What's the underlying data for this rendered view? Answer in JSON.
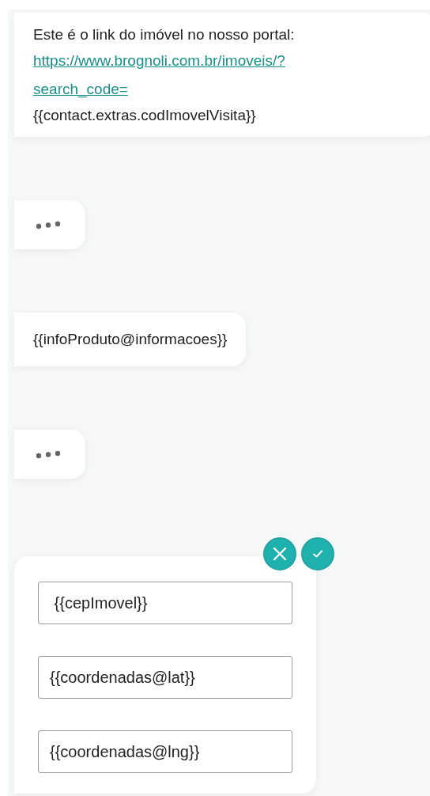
{
  "messages": [
    {
      "kind": "text",
      "text": "Este é o link do imóvel no nosso portal:",
      "link": "https://www.brognoli.com.br/imoveis/?search_code=",
      "after": "{{contact.extras.codImovelVisita}}"
    },
    {
      "kind": "typing"
    },
    {
      "kind": "text",
      "text": "{{infoProduto@informacoes}}"
    },
    {
      "kind": "typing"
    },
    {
      "kind": "form",
      "fields": [
        {
          "value": " {{cepImovel}}"
        },
        {
          "value": "{{coordenadas@lat}}"
        },
        {
          "value": "{{coordenadas@lng}}"
        }
      ]
    }
  ]
}
